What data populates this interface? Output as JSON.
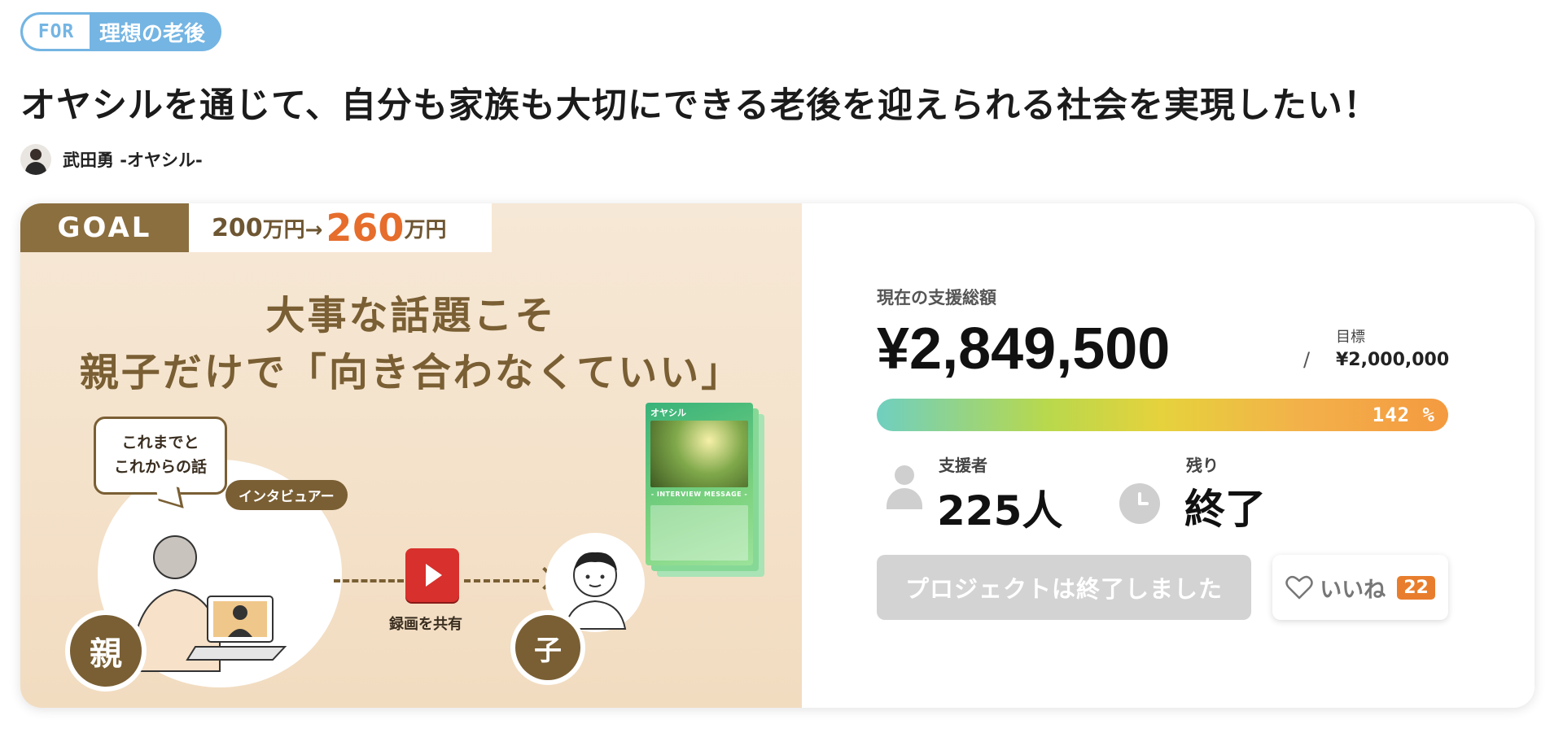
{
  "tag": {
    "prefix": "FOR",
    "label": "理想の老後"
  },
  "project": {
    "title": "オヤシルを通じて、自分も家族も大切にできる老後を迎えられる社会を実現したい！",
    "owner_name": "武田勇 -オヤシル-"
  },
  "hero": {
    "goal_label": "GOAL",
    "goal_from": "200",
    "goal_from_unit": "万円→",
    "goal_to": "260",
    "goal_to_unit": "万円",
    "headline_1": "大事な話題こそ",
    "headline_2": "親子だけで「向き合わなくていい」",
    "bubble_line_1": "これまでと",
    "bubble_line_2": "これからの話",
    "interviewer_label": "インタビュアー",
    "share_label": "録画を共有",
    "parent_badge": "親",
    "child_badge": "子",
    "booklet_brand": "オヤシル",
    "booklet_caption": "- INTERVIEW MESSAGE -"
  },
  "funding": {
    "raised_label": "現在の支援総額",
    "raised_amount": "¥2,849,500",
    "slash": "/",
    "target_label": "目標",
    "target_amount": "¥2,000,000",
    "progress_percent_text": "142 %",
    "progress_fraction": 1.0,
    "backers_label": "支援者",
    "backers_value": "225人",
    "remaining_label": "残り",
    "remaining_value": "終了",
    "ended_button_label": "プロジェクトは終了しました",
    "like_label": "いいね",
    "like_count": "22"
  },
  "colors": {
    "tag_blue": "#74b5e3",
    "goal_brown": "#8c6f3f",
    "goal_orange": "#e66d2c",
    "like_orange": "#e87e2d",
    "ended_gray": "#d3d3d3"
  },
  "icons": [
    "person-icon",
    "clock-icon",
    "heart-icon",
    "play-icon"
  ]
}
